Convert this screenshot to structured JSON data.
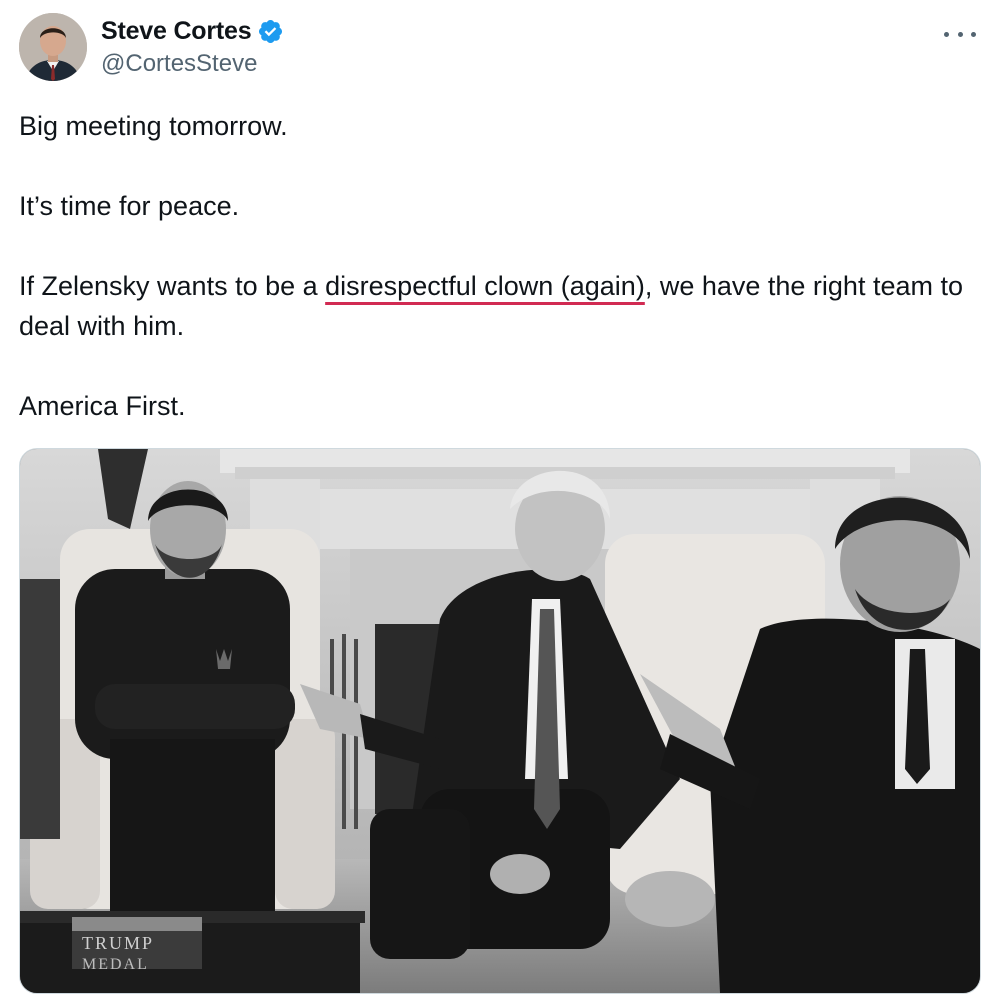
{
  "author": {
    "name": "Steve Cortes",
    "handle": "@CortesSteve",
    "verified": true,
    "avatar_icon": "avatar-photo"
  },
  "tweet": {
    "lines": [
      "Big meeting tomorrow.",
      "It’s time for peace.",
      "If Zelensky wants to be a ",
      "disrespectful clown (again)",
      ", we have the right team to deal with him.",
      "America First."
    ]
  },
  "media": {
    "type": "photo",
    "style": "black-and-white",
    "book_text_line1": "TRUMP",
    "book_text_line2": "MEDAL"
  },
  "colors": {
    "text": "#0f1419",
    "secondary": "#536471",
    "verified": "#1d9bf0",
    "underline": "#d12a52"
  }
}
